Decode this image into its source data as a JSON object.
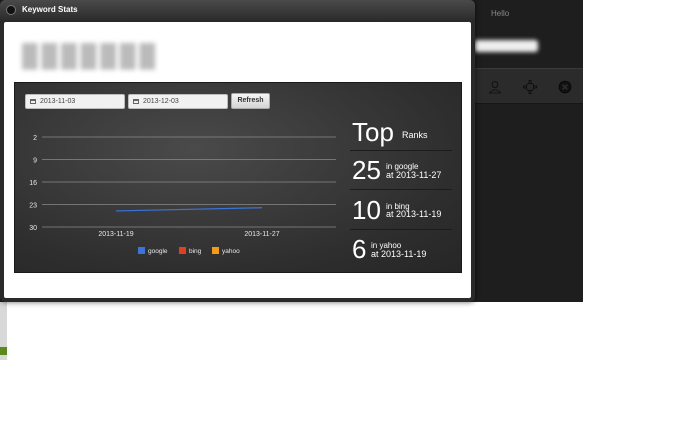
{
  "background_app": {
    "greeting": "Hello"
  },
  "dialog": {
    "title": "Keyword Stats"
  },
  "filters": {
    "start_date": "2013-11-03",
    "end_date": "2013-12-03",
    "refresh_label": "Refresh"
  },
  "chart_data": {
    "type": "line",
    "title": "",
    "xlabel": "",
    "ylabel": "",
    "y_inverted": true,
    "ylim": [
      2,
      30
    ],
    "yticks": [
      "2",
      "9",
      "16",
      "23",
      "30"
    ],
    "xticks": [
      "2013-11-19",
      "2013-11-27"
    ],
    "grid": true,
    "legend_position": "bottom",
    "series": [
      {
        "name": "google",
        "color": "#3b73d8",
        "points": [
          {
            "x": "2013-11-19",
            "y": 25
          },
          {
            "x": "2013-11-27",
            "y": 24
          }
        ]
      },
      {
        "name": "bing",
        "color": "#e0401c",
        "points": []
      },
      {
        "name": "yahoo",
        "color": "#f29a1a",
        "points": []
      }
    ]
  },
  "top_ranks": {
    "heading": "Top",
    "subheading": "Ranks",
    "items": [
      {
        "rank": "25",
        "engine": "in google",
        "date": "at 2013-11-27"
      },
      {
        "rank": "10",
        "engine": "in bing",
        "date": "at 2013-11-19"
      },
      {
        "rank": "6",
        "engine": "in yahoo",
        "date": "at 2013-11-19"
      }
    ]
  },
  "icons": {
    "title_bar": "close-icon",
    "date_inputs": "calendar-icon",
    "toolbar": [
      "user-icon",
      "gear-icon",
      "close-circle-icon"
    ]
  }
}
